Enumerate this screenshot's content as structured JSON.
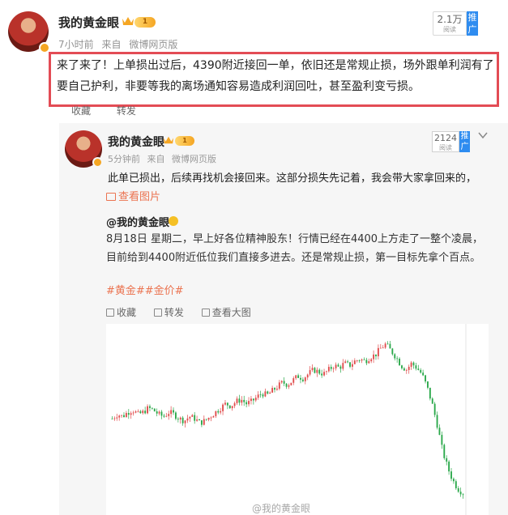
{
  "post": {
    "username": "我的黄金眼",
    "level": "1",
    "time": "7小时前",
    "source_prefix": "来自",
    "source": "微博网页版",
    "views": "2.1万",
    "views_label": "阅读",
    "promote": "推广",
    "text": "来了来了！上单损出过后，4390附近接回一单，依旧还是常规止损，场外跟单利润有了要自己护利，非要等我的离场通知容易造成利润回吐，甚至盈利变亏损。",
    "actions": [
      "收藏",
      "转发"
    ]
  },
  "repost": {
    "username": "我的黄金眼",
    "level": "1",
    "time": "5分钟前",
    "source_prefix": "来自",
    "source": "微博网页版",
    "views": "2124",
    "views_label": "阅读",
    "promote": "推广",
    "text": "此单已损出，后续再找机会接回来。这部分损失先记着，我会带大家拿回来的，",
    "image_link": "查看图片",
    "quote": {
      "author": "@我的黄金眼",
      "text": "8月18日 星期二，早上好各位精神股东！行情已经在4400上方走了一整个凌晨，目前给到4400附近低位我们直接多进去。还是常规止损，第一目标先拿个百点。",
      "hashtags": "#黄金##金价#",
      "actions": [
        "收藏",
        "转发",
        "查看大图"
      ]
    }
  },
  "chart": {
    "watermark": "@我的黄金眼",
    "up_color": "#e04b4b",
    "down_color": "#2aa84a"
  },
  "chart_data": {
    "type": "candlestick",
    "title": "",
    "xlabel": "",
    "ylabel": "",
    "series": [
      {
        "trend": [
          4395,
          4397,
          4396,
          4398,
          4399,
          4397,
          4398,
          4400,
          4399,
          4397,
          4396,
          4398,
          4397,
          4395,
          4394,
          4396,
          4395,
          4393,
          4394,
          4396,
          4398,
          4400,
          4402,
          4401,
          4403,
          4404,
          4402,
          4403,
          4405,
          4407,
          4406,
          4408,
          4410,
          4412,
          4411,
          4413,
          4415,
          4414,
          4416,
          4418,
          4417,
          4416,
          4418,
          4420,
          4419,
          4421,
          4420,
          4422,
          4423,
          4422,
          4424,
          4425,
          4428,
          4430,
          4427,
          4424,
          4420,
          4418,
          4421,
          4419,
          4416,
          4410,
          4402,
          4392,
          4380,
          4372,
          4366,
          4362,
          4360
        ]
      }
    ]
  }
}
